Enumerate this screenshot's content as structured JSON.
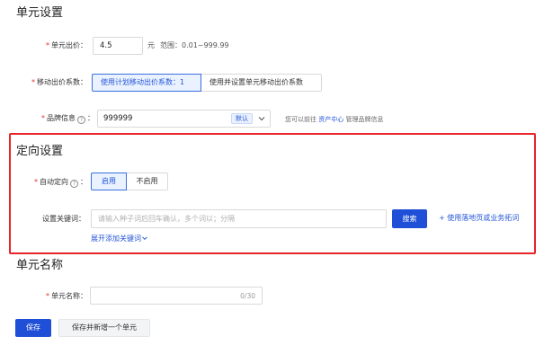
{
  "unit_settings": {
    "title": "单元设置",
    "bid": {
      "label": "单元出价",
      "value": "4.5",
      "unit": "元",
      "range": "范围：0.01~999.99"
    },
    "mobile_coef": {
      "label": "移动出价系数",
      "options": [
        "使用计划移动出价系数：1",
        "使用并设置单元移动出价系数"
      ],
      "selected": 0
    },
    "brand": {
      "label": "品牌信息",
      "value": "999999",
      "default_tag": "默认",
      "hint_prefix": "您可以前往",
      "hint_link": "资产中心",
      "hint_suffix": "管理品牌信息"
    }
  },
  "targeting": {
    "title": "定向设置",
    "auto": {
      "label": "自动定向",
      "options": [
        "启用",
        "不启用"
      ],
      "selected": 0
    },
    "keywords": {
      "label": "设置关键词：",
      "placeholder": "请输入种子词后回车确认，多个词以；分隔",
      "search_label": "搜索",
      "landing_link": "+ 使用落地页或业务拓词",
      "expand_label": "展开添加关键词"
    }
  },
  "unit_name": {
    "title": "单元名称",
    "label": "单元名称",
    "value": "",
    "counter": "0/30"
  },
  "actions": {
    "save_label": "保存",
    "save_new_label": "保存并新增一个单元"
  },
  "colors": {
    "primary": "#1f4fd6",
    "highlight": "#e5252a",
    "required": "#e0312f"
  }
}
